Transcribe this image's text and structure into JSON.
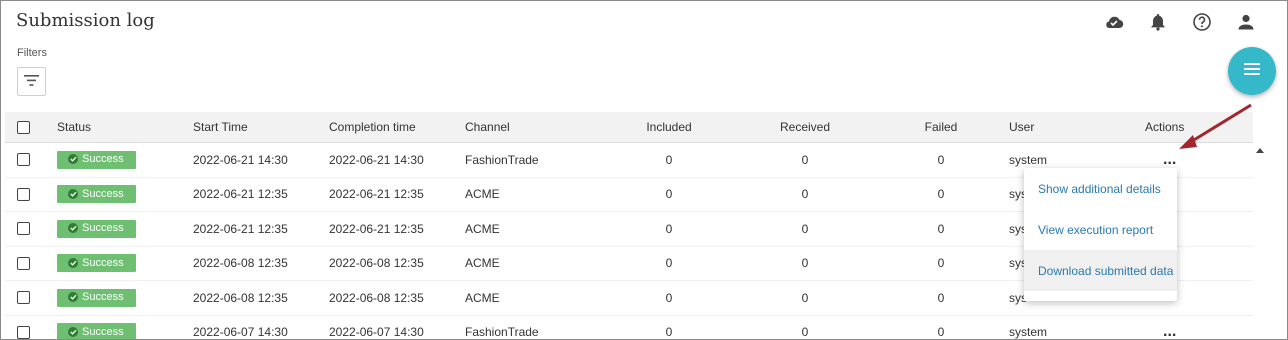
{
  "page": {
    "title": "Submission log"
  },
  "filters": {
    "label": "Filters"
  },
  "icons": {
    "cloud": "cloud-icon",
    "bell": "bell-icon",
    "help": "help-icon",
    "user": "user-icon",
    "filter": "filter-icon",
    "menu": "menu-icon"
  },
  "colors": {
    "success": "#6fbf73",
    "fab": "#35b8c9",
    "link": "#2a7ab0",
    "arrow": "#a3262e"
  },
  "table": {
    "headers": {
      "status": "Status",
      "start": "Start Time",
      "completion": "Completion time",
      "channel": "Channel",
      "included": "Included",
      "received": "Received",
      "failed": "Failed",
      "user": "User",
      "actions": "Actions"
    },
    "rows": [
      {
        "status": "Success",
        "start": "2022-06-21 14:30",
        "completion": "2022-06-21 14:30",
        "channel": "FashionTrade",
        "included": "0",
        "received": "0",
        "failed": "0",
        "user": "system",
        "actions": "..."
      },
      {
        "status": "Success",
        "start": "2022-06-21 12:35",
        "completion": "2022-06-21 12:35",
        "channel": "ACME",
        "included": "0",
        "received": "0",
        "failed": "0",
        "user": "sys",
        "actions": ""
      },
      {
        "status": "Success",
        "start": "2022-06-21 12:35",
        "completion": "2022-06-21 12:35",
        "channel": "ACME",
        "included": "0",
        "received": "0",
        "failed": "0",
        "user": "sys",
        "actions": ""
      },
      {
        "status": "Success",
        "start": "2022-06-08 12:35",
        "completion": "2022-06-08 12:35",
        "channel": "ACME",
        "included": "0",
        "received": "0",
        "failed": "0",
        "user": "sys",
        "actions": ""
      },
      {
        "status": "Success",
        "start": "2022-06-08 12:35",
        "completion": "2022-06-08 12:35",
        "channel": "ACME",
        "included": "0",
        "received": "0",
        "failed": "0",
        "user": "sys",
        "actions": ""
      },
      {
        "status": "Success",
        "start": "2022-06-07 14:30",
        "completion": "2022-06-07 14:30",
        "channel": "FashionTrade",
        "included": "0",
        "received": "0",
        "failed": "0",
        "user": "system",
        "actions": "..."
      }
    ]
  },
  "menu": {
    "items": [
      "Show additional details",
      "View execution report",
      "Download submitted data"
    ]
  }
}
